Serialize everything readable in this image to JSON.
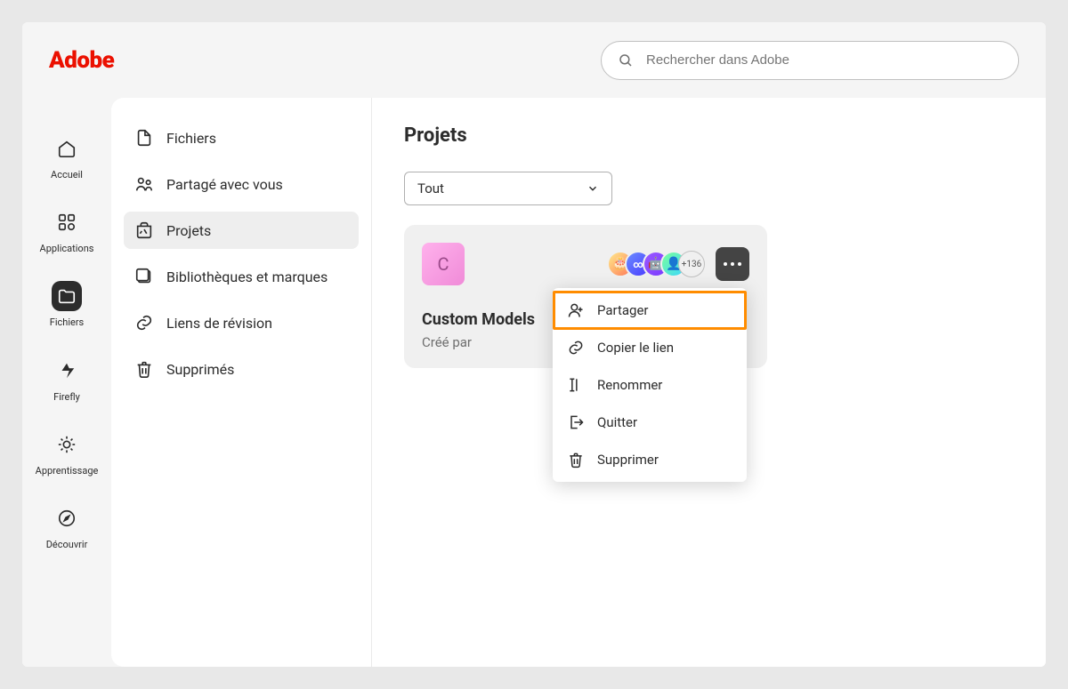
{
  "logo": "Adobe",
  "search": {
    "placeholder": "Rechercher dans Adobe"
  },
  "rail": [
    {
      "label": "Accueil"
    },
    {
      "label": "Applications"
    },
    {
      "label": "Fichiers"
    },
    {
      "label": "Firefly"
    },
    {
      "label": "Apprentissage"
    },
    {
      "label": "Découvrir"
    }
  ],
  "sidebar": [
    {
      "label": "Fichiers"
    },
    {
      "label": "Partagé avec vous"
    },
    {
      "label": "Projets"
    },
    {
      "label": "Bibliothèques et marques"
    },
    {
      "label": "Liens de révision"
    },
    {
      "label": "Supprimés"
    }
  ],
  "main": {
    "title": "Projets",
    "filter": "Tout",
    "project": {
      "thumb_letter": "C",
      "more_count": "+136",
      "title": "Custom Models",
      "subtitle": "Créé par"
    },
    "menu": [
      "Partager",
      "Copier le lien",
      "Renommer",
      "Quitter",
      "Supprimer"
    ]
  }
}
